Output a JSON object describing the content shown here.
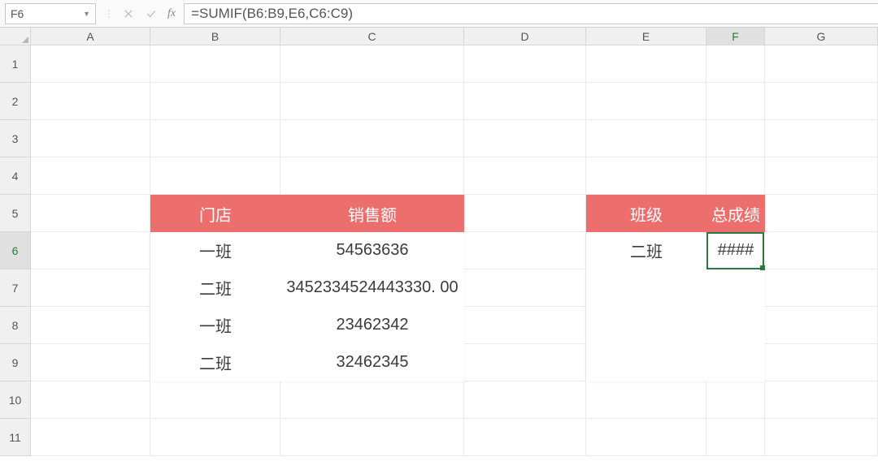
{
  "formula_bar": {
    "cell_ref": "F6",
    "formula": "=SUMIF(B6:B9,E6,C6:C9)",
    "fx_label": "fx"
  },
  "columns": [
    "A",
    "B",
    "C",
    "D",
    "E",
    "F",
    "G"
  ],
  "selected": {
    "col": "F",
    "row": 6
  },
  "row_count": 11,
  "table1": {
    "headers": [
      "门店",
      "销售额"
    ],
    "rows": [
      [
        "一班",
        "54563636"
      ],
      [
        "二班",
        "3452334524443330. 00"
      ],
      [
        "一班",
        "23462342"
      ],
      [
        "二班",
        "32462345"
      ]
    ]
  },
  "table2": {
    "headers": [
      "班级",
      "总成绩"
    ],
    "rows": [
      [
        "二班",
        "####"
      ],
      [
        "",
        ""
      ],
      [
        "",
        ""
      ],
      [
        "",
        ""
      ]
    ]
  },
  "colors": {
    "header_bg": "#ec6e6d",
    "selection": "#2a7a3f"
  },
  "chart_data": {
    "type": "table",
    "tables": [
      {
        "title": "",
        "columns": [
          "门店",
          "销售额"
        ],
        "rows": [
          [
            "一班",
            54563636
          ],
          [
            "二班",
            3452334524443330.0
          ],
          [
            "一班",
            23462342
          ],
          [
            "二班",
            32462345
          ]
        ]
      },
      {
        "title": "",
        "columns": [
          "班级",
          "总成绩"
        ],
        "rows": [
          [
            "二班",
            "####"
          ]
        ]
      }
    ]
  }
}
